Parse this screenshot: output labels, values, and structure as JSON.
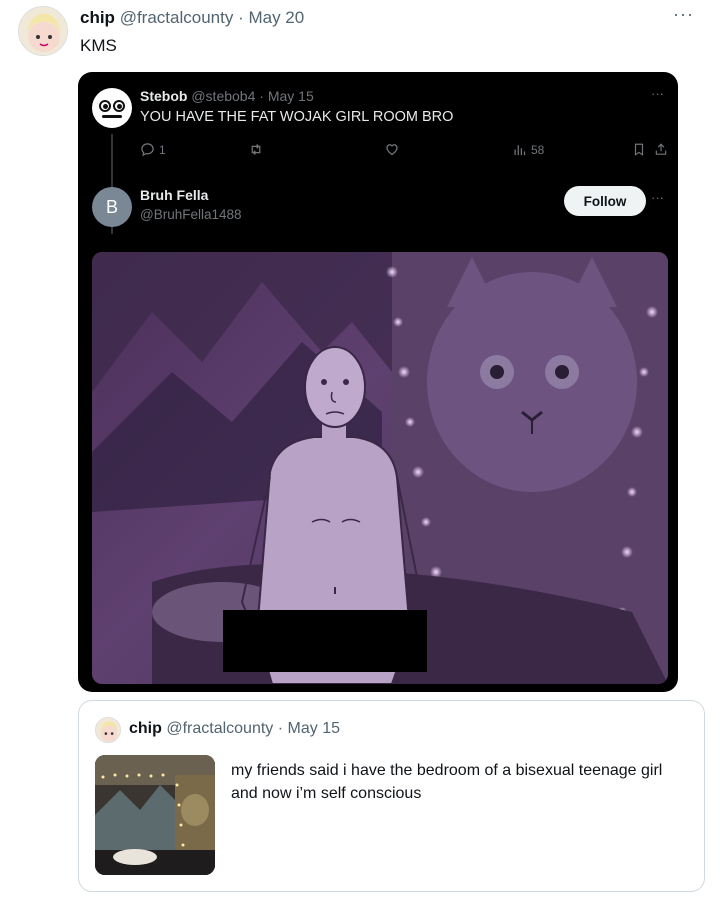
{
  "tweet": {
    "author_name": "chip",
    "author_handle": "@fractalcounty",
    "separator": "·",
    "date": "May 20",
    "text": "KMS",
    "more_icon": "more-horizontal-icon"
  },
  "embedded": {
    "reply": {
      "author_name": "Stebob",
      "author_handle": "@stebob4",
      "separator": "·",
      "date": "May 15",
      "text": "YOU HAVE THE FAT WOJAK GIRL ROOM BRO",
      "reply_count": "1",
      "views": "58"
    },
    "account": {
      "avatar_letter": "B",
      "name": "Bruh Fella",
      "handle": "@BruhFella1488",
      "follow_label": "Follow"
    }
  },
  "quote": {
    "author_name": "chip",
    "author_handle": "@fractalcounty",
    "separator": "·",
    "date": "May 15",
    "text": "my friends said i have the bedroom of a bisexual teenage girl and now i’m self  conscious"
  },
  "colors": {
    "dark_bg": "#000000",
    "muted_dark": "#71767b",
    "muted_light": "#536471",
    "photo_tint": "#5f4070"
  }
}
